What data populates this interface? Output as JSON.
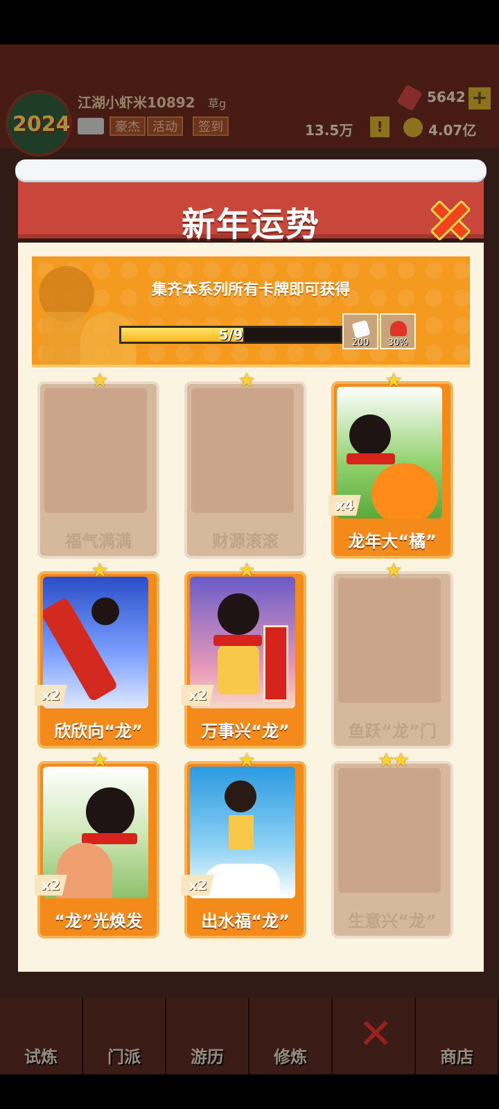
{
  "hud": {
    "avatar_year": "2024",
    "player_name": "江湖小虾米10892",
    "player_rank": "草g",
    "buttons": [
      "豪杰",
      "活动",
      "签到"
    ],
    "gems": "5642",
    "plus": "+",
    "resource1": "13.5万",
    "warn": "!",
    "resource2": "4.07亿"
  },
  "modal": {
    "title": "新年运势",
    "banner_text": "集齐本系列所有卡牌即可获得",
    "progress": {
      "current": 5,
      "total": 9,
      "label": "5/9"
    },
    "rewards": [
      {
        "icon": "dice-icon",
        "value": "200"
      },
      {
        "icon": "heart-icon",
        "value": "30%"
      }
    ]
  },
  "cards": [
    {
      "label": "福气满满",
      "stars": "★",
      "owned": false,
      "count": ""
    },
    {
      "label": "财源滚滚",
      "stars": "★",
      "owned": false,
      "count": ""
    },
    {
      "label": "龙年大“橘”",
      "stars": "★",
      "owned": true,
      "count": "x4"
    },
    {
      "label": "欣欣向“龙”",
      "stars": "★",
      "owned": true,
      "count": "x2"
    },
    {
      "label": "万事兴“龙”",
      "stars": "★",
      "owned": true,
      "count": "x2"
    },
    {
      "label": "鱼跃“龙”门",
      "stars": "★",
      "owned": false,
      "count": ""
    },
    {
      "label": "“龙”光焕发",
      "stars": "★",
      "owned": true,
      "count": "x2"
    },
    {
      "label": "出水福“龙”",
      "stars": "★",
      "owned": true,
      "count": "x2"
    },
    {
      "label": "生意兴“龙”",
      "stars": "★★",
      "owned": false,
      "count": ""
    }
  ],
  "bottom_nav": {
    "tabs": [
      "试炼",
      "门派",
      "游历",
      "修炼",
      "",
      "商店"
    ]
  },
  "colors": {
    "header_red": "#c9463a",
    "banner_orange": "#f39a1f",
    "card_orange": "#f38a1a",
    "locked_card": "#d6b99c",
    "star_gold": "#ffd234"
  }
}
